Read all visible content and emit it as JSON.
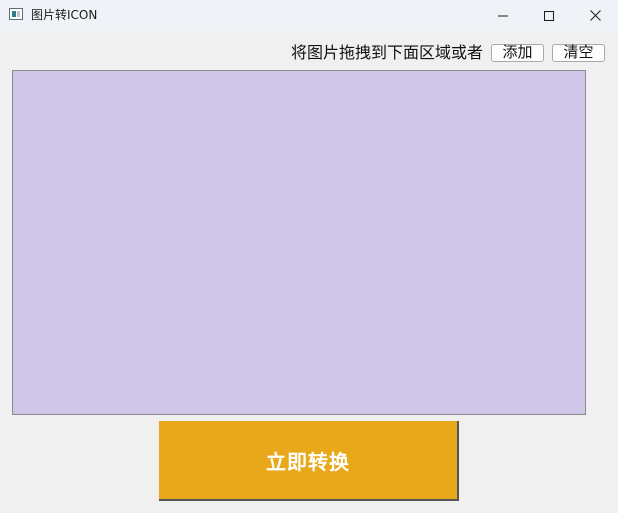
{
  "window": {
    "title": "图片转ICON",
    "icon": "app-image-icon",
    "controls": {
      "minimize": "minimize-icon",
      "maximize": "maximize-icon",
      "close": "close-icon"
    }
  },
  "toolbar": {
    "hint": "将图片拖拽到下面区域或者",
    "add_label": "添加",
    "clear_label": "清空"
  },
  "drop_area": {
    "background_color": "#cec5e8"
  },
  "action": {
    "convert_label": "立即转换",
    "convert_color": "#e8a81a"
  }
}
